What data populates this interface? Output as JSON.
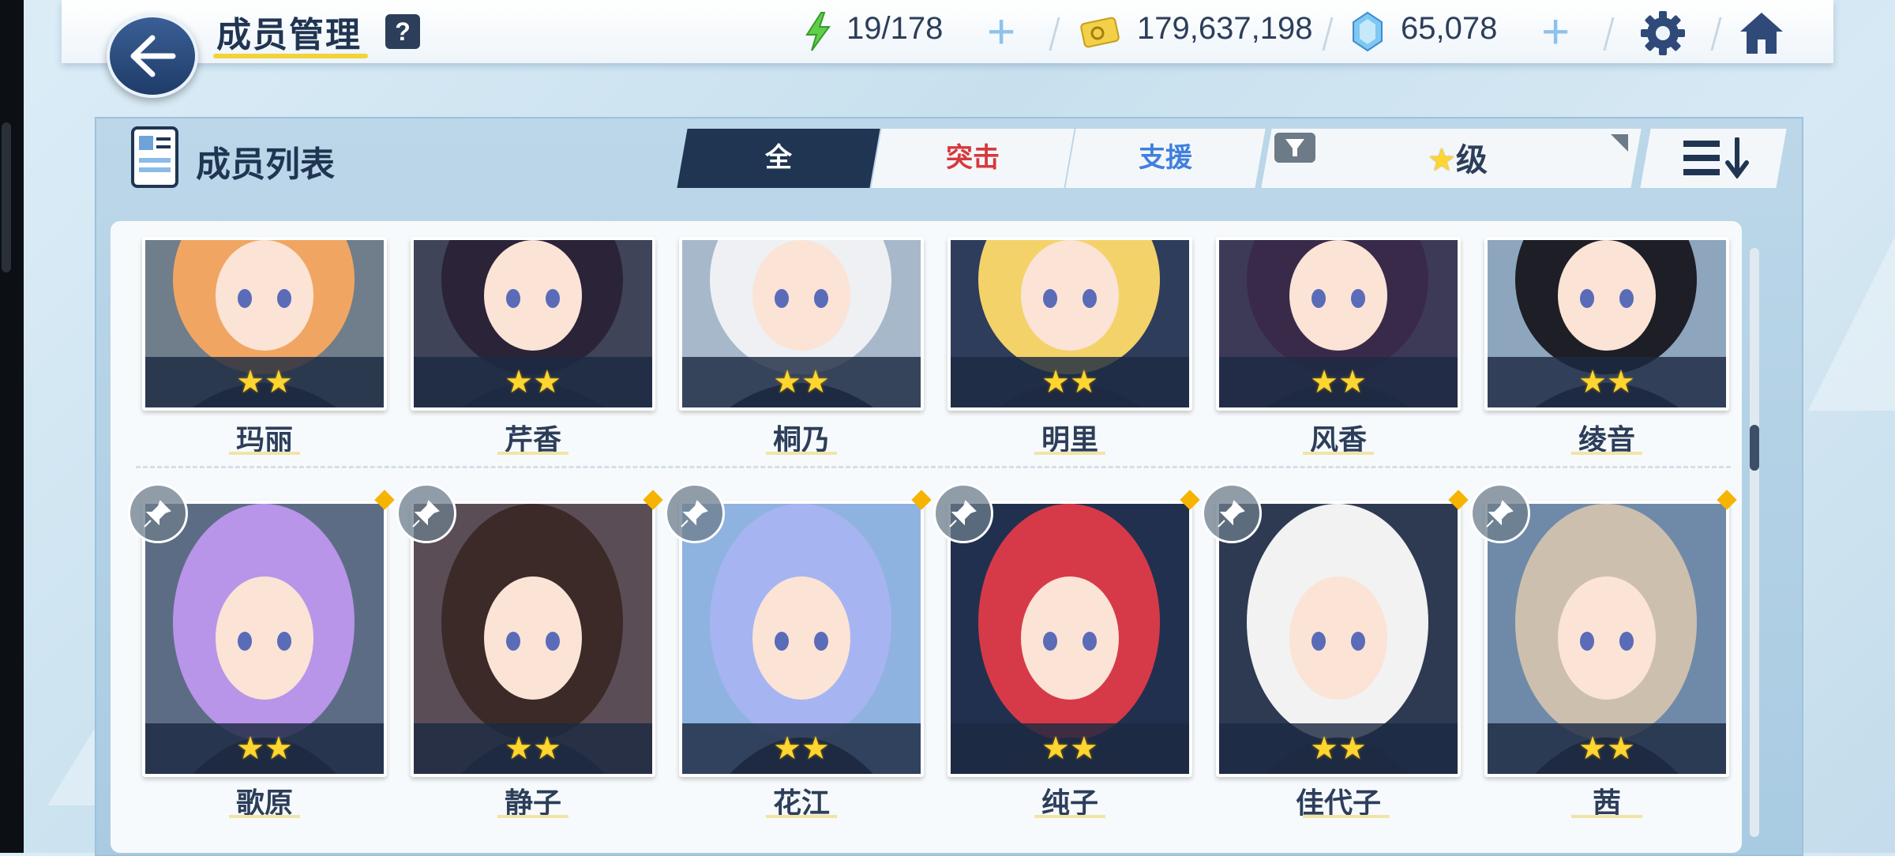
{
  "header": {
    "title": "成员管理",
    "help_label": "?",
    "ap": "19/178",
    "credits": "179,637,198",
    "gems": "65,078",
    "plus_label": "+"
  },
  "panel": {
    "title": "成员列表",
    "tabs": [
      {
        "label": "全",
        "color": "#ffffff"
      },
      {
        "label": "突击",
        "color": "#d6393c"
      },
      {
        "label": "支援",
        "color": "#3f7fe0"
      }
    ],
    "sort_label": "级",
    "sort_star": "★"
  },
  "members": [
    {
      "name": "玛丽",
      "stars": "★★",
      "hair": "#f0a662",
      "bg": "#6f7e8a"
    },
    {
      "name": "芹香",
      "stars": "★★",
      "hair": "#2b2338",
      "bg": "#3f4458"
    },
    {
      "name": "桐乃",
      "stars": "★★",
      "hair": "#eef0f3",
      "bg": "#a7b8cb"
    },
    {
      "name": "明里",
      "stars": "★★",
      "hair": "#f3d269",
      "bg": "#2f3d5c"
    },
    {
      "name": "风香",
      "stars": "★★",
      "hair": "#3a2a4a",
      "bg": "#3d3a58"
    },
    {
      "name": "绫音",
      "stars": "★★",
      "hair": "#1e1e26",
      "bg": "#8ea6bd"
    },
    {
      "name": "歌原",
      "stars": "★★",
      "hair": "#b895e8",
      "bg": "#5d6c85"
    },
    {
      "name": "静子",
      "stars": "★★",
      "hair": "#3b2a28",
      "bg": "#5a4d56"
    },
    {
      "name": "花江",
      "stars": "★★",
      "hair": "#a7b4f2",
      "bg": "#8fb3e0"
    },
    {
      "name": "纯子",
      "stars": "★★",
      "hair": "#d63a48",
      "bg": "#22304f"
    },
    {
      "name": "佳代子",
      "stars": "★★",
      "hair": "#f2f2f2",
      "bg": "#2d3a52"
    },
    {
      "name": "茜",
      "stars": "★★",
      "hair": "#cdbfae",
      "bg": "#6e8aa8"
    }
  ]
}
